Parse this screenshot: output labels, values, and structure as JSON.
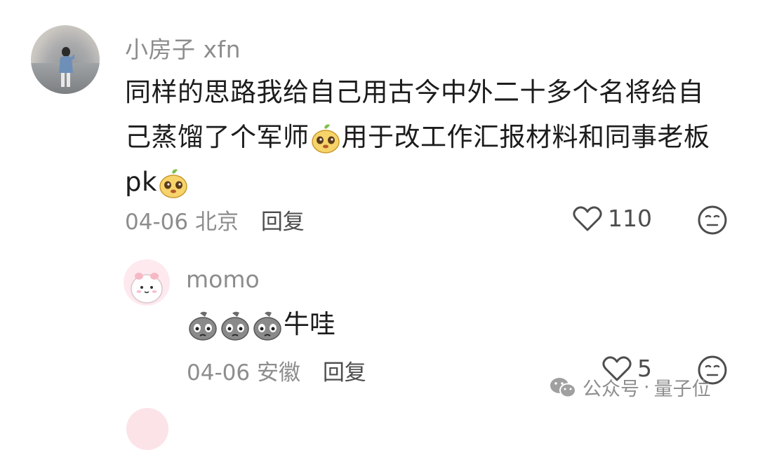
{
  "comment": {
    "username": "小房子 xfn",
    "text_line_1": "同样的思路我给自己用古今中外二十多个名将给自",
    "text_line_2a": "己蒸馏了个军师",
    "text_line_2b": "用于改工作汇报材料和同事老板",
    "text_line_3": "pk",
    "date": "04-06",
    "location": "北京",
    "reply_label": "回复",
    "like_count": "110"
  },
  "reply": {
    "username": "momo",
    "text": "牛哇",
    "date": "04-06",
    "location": "安徽",
    "reply_label": "回复",
    "like_count": "5"
  },
  "watermark": {
    "prefix": "公众号",
    "separator": "·",
    "name": "量子位"
  },
  "icons": {
    "like": "heart-outline-icon",
    "dislike": "neutral-face-icon",
    "emoji_1": "yellow-sprout-face-emoji",
    "emoji_2": "gray-sad-face-emoji",
    "watermark": "wechat-icon"
  },
  "colors": {
    "text": "#1c1c1c",
    "muted": "#8d8d8d",
    "action": "#4d4d4d"
  }
}
